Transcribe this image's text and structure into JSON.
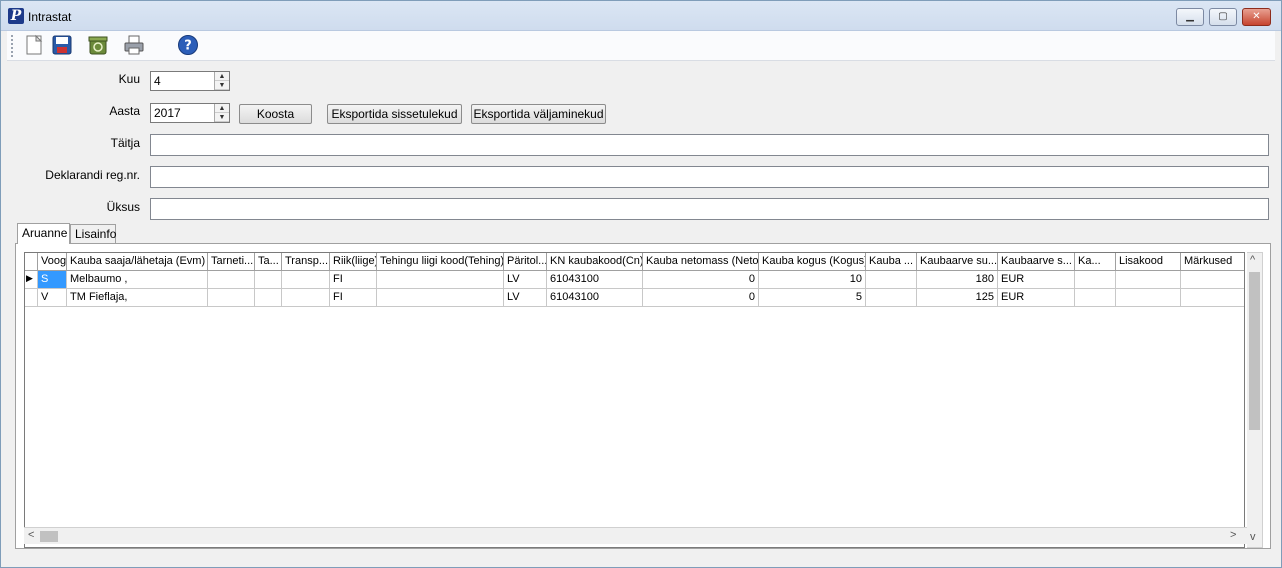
{
  "window": {
    "title": "Intrastat",
    "app_icon_letter": "P",
    "min_glyph": "▁",
    "max_glyph": "▢",
    "close_glyph": "✕"
  },
  "toolbar": {
    "icons": [
      "new-document-icon",
      "save-icon",
      "recycle-bin-icon",
      "print-icon",
      "help-icon"
    ]
  },
  "form": {
    "kuu_label": "Kuu",
    "kuu_value": "4",
    "aasta_label": "Aasta",
    "aasta_value": "2017",
    "koosta_label": "Koosta",
    "export_in_label": "Eksportida sissetulekud",
    "export_out_label": "Eksportida väljaminekud",
    "taitja_label": "Täitja",
    "taitja_value": "",
    "deklarandi_label": "Deklarandi reg.nr.",
    "deklarandi_value": "",
    "uksus_label": "Üksus",
    "uksus_value": ""
  },
  "tabs": [
    {
      "label": "Aruanne",
      "active": true
    },
    {
      "label": "Lisainfo",
      "active": false
    }
  ],
  "grid": {
    "columns": [
      "Voog",
      "Kauba saaja/lähetaja (Evm)",
      "Tarneti...",
      "Ta...",
      "Transp...",
      "Riik(liige)",
      "Tehingu liigi kood(Tehing)",
      "Päritol...",
      "KN kaubakood(Cn)",
      "Kauba netomass (Neto)",
      "Kauba kogus (Kogus)",
      "Kauba ...",
      "Kaubaarve su...",
      "Kaubaarve s...",
      "Ka...",
      "Lisakood",
      "Märkused"
    ],
    "rows": [
      [
        "S",
        "Melbaumo ,",
        "",
        "",
        "",
        "FI",
        "",
        "LV",
        "61043100",
        "0",
        "10",
        "",
        "180",
        "EUR",
        "",
        "",
        ""
      ],
      [
        "V",
        "TM Fieflaja,",
        "",
        "",
        "",
        "FI",
        "",
        "LV",
        "61043100",
        "0",
        "5",
        "",
        "125",
        "EUR",
        "",
        "",
        ""
      ]
    ]
  }
}
